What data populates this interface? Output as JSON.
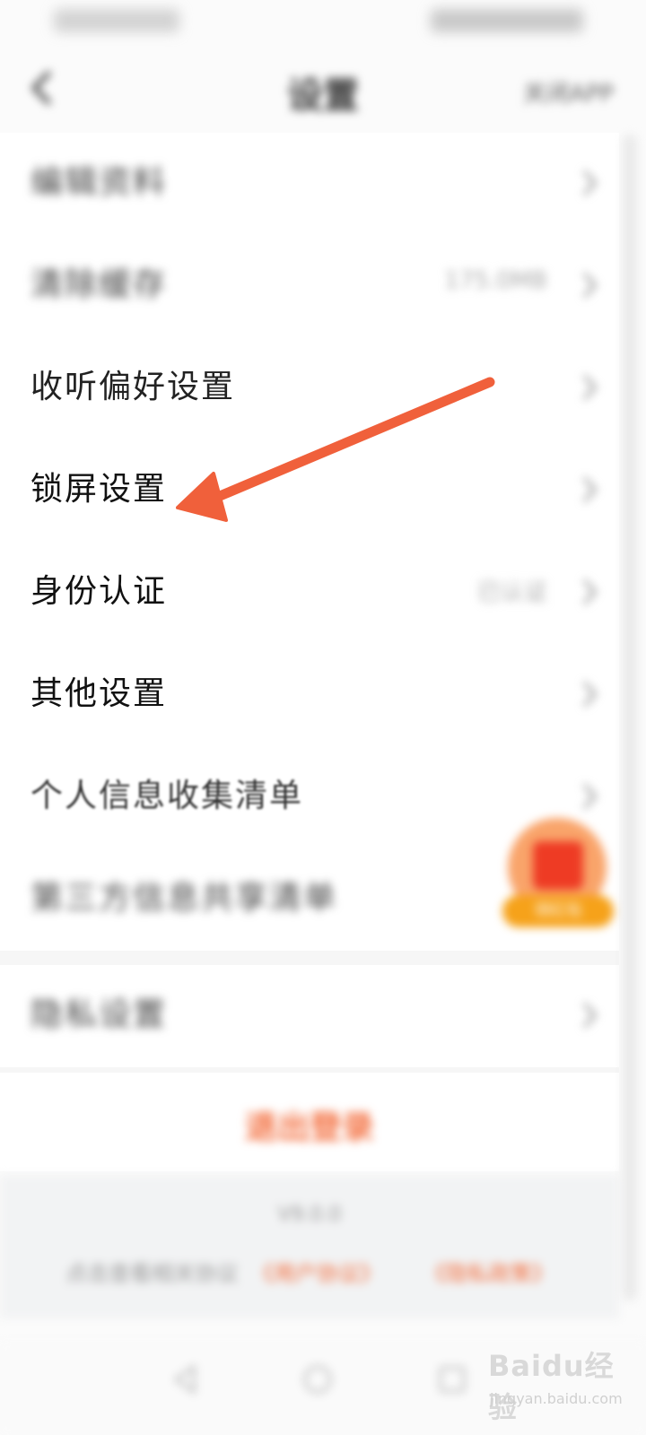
{
  "nav": {
    "title": "设置",
    "right_action": "关闭APP"
  },
  "rows": [
    {
      "label": "编辑资料",
      "value": ""
    },
    {
      "label": "清除缓存",
      "value": "175.0MB"
    },
    {
      "label": "收听偏好设置",
      "value": ""
    },
    {
      "label": "锁屏设置",
      "value": ""
    },
    {
      "label": "身份认证",
      "value": "已认证"
    },
    {
      "label": "其他设置",
      "value": ""
    },
    {
      "label": "个人信息收集清单",
      "value": ""
    },
    {
      "label": "第三方信息共享清单",
      "value": ""
    },
    {
      "label": "隐私设置",
      "value": ""
    }
  ],
  "logout": {
    "label": "退出登录"
  },
  "footer": {
    "version": "V9.0.0",
    "text": "点击查看相关协议",
    "link_1": "《用户协议》",
    "link_2": "《隐私政策》"
  },
  "promo": {
    "label": "领红包"
  },
  "watermark": {
    "brand": "Baidu经验",
    "url": "jingyan.baidu.com"
  },
  "colors": {
    "accent": "#f36b3a",
    "annotation_arrow": "#f0603b"
  }
}
